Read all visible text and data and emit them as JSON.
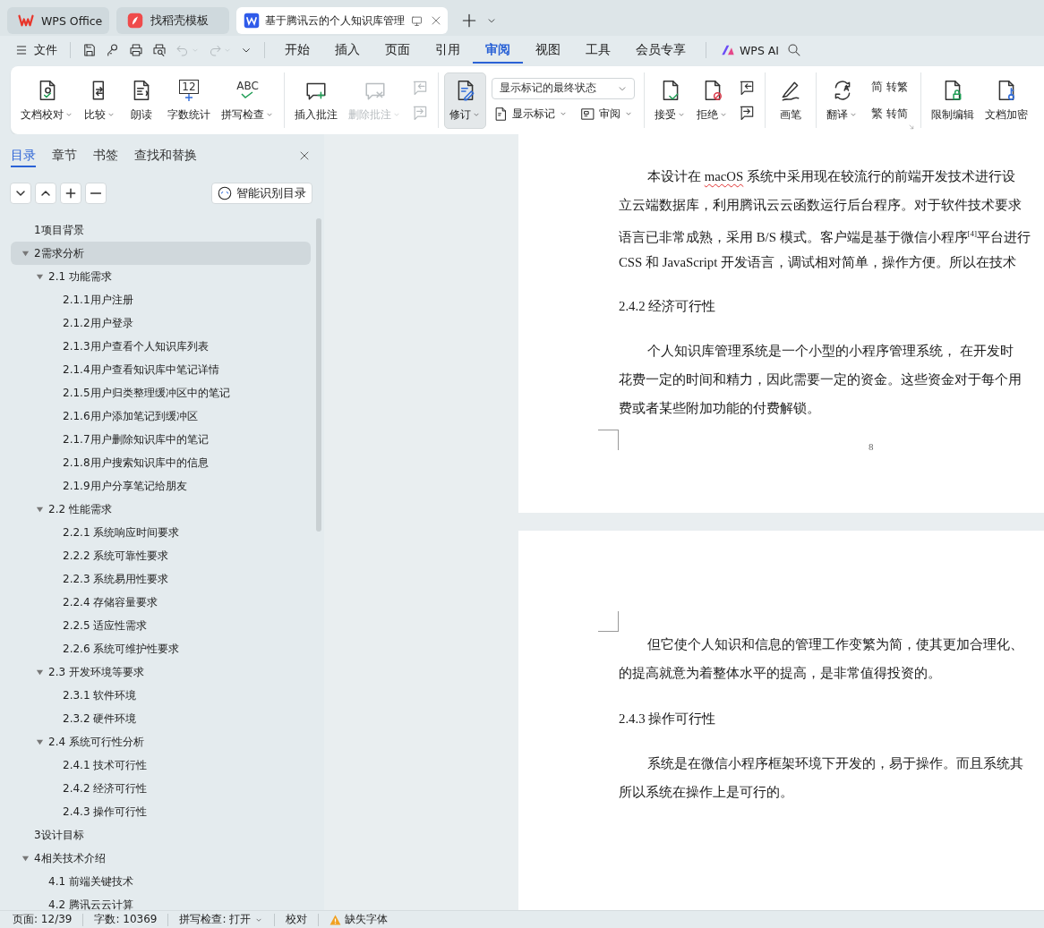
{
  "title_tabs": [
    {
      "label": "WPS Office",
      "selected": false
    },
    {
      "label": "找稻壳模板",
      "selected": false
    },
    {
      "label": "基于腾讯云的个人知识库管理",
      "selected": true
    }
  ],
  "menu_bar": {
    "file_menu": "文件",
    "quick_access": [
      {
        "disabled": false
      },
      {
        "disabled": false
      },
      {
        "disabled": false
      },
      {
        "disabled": false
      },
      {
        "disabled": true
      },
      {
        "disabled": true
      }
    ],
    "tabs": [
      {
        "label": "开始",
        "selected": false
      },
      {
        "label": "插入",
        "selected": false
      },
      {
        "label": "页面",
        "selected": false
      },
      {
        "label": "引用",
        "selected": false
      },
      {
        "label": "审阅",
        "selected": true
      },
      {
        "label": "视图",
        "selected": false
      },
      {
        "label": "工具",
        "selected": false
      },
      {
        "label": "会员专享",
        "selected": false
      }
    ],
    "ai_button": "WPS AI"
  },
  "ribbon": {
    "groups": [
      {
        "items": [
          {
            "kind": "big",
            "label": "文档校对",
            "caret": true,
            "disabled": false,
            "pressed": false
          },
          {
            "kind": "big",
            "label": "比较",
            "caret": true,
            "disabled": false,
            "pressed": false
          },
          {
            "kind": "big",
            "label": "朗读",
            "caret": false,
            "disabled": false,
            "pressed": false
          },
          {
            "kind": "big",
            "label": "字数统计",
            "caret": false,
            "disabled": false,
            "pressed": false,
            "glyph": "12"
          },
          {
            "kind": "big",
            "label": "拼写检查",
            "caret": true,
            "disabled": false,
            "pressed": false,
            "glyph": "ABC"
          }
        ]
      },
      {
        "items": [
          {
            "kind": "big",
            "label": "插入批注",
            "caret": false,
            "disabled": false,
            "pressed": false
          },
          {
            "kind": "big",
            "label": "删除批注",
            "caret": true,
            "disabled": true,
            "pressed": false
          },
          {
            "kind": "nav",
            "disabled": true
          }
        ]
      },
      {
        "items": [
          {
            "kind": "big",
            "label": "修订",
            "caret": true,
            "disabled": false,
            "pressed": true
          },
          {
            "kind": "markup",
            "select": "显示标记的最终状态",
            "buttons": [
              {
                "label": "显示标记",
                "caret": true
              },
              {
                "label": "审阅",
                "caret": true
              }
            ]
          }
        ]
      },
      {
        "items": [
          {
            "kind": "big",
            "label": "接受",
            "caret": true,
            "disabled": false,
            "pressed": false
          },
          {
            "kind": "big",
            "label": "拒绝",
            "caret": true,
            "disabled": false,
            "pressed": false
          },
          {
            "kind": "nav",
            "disabled": false
          }
        ]
      },
      {
        "items": [
          {
            "kind": "big",
            "label": "画笔",
            "caret": false,
            "disabled": false,
            "pressed": false
          }
        ]
      },
      {
        "items": [
          {
            "kind": "big",
            "label": "翻译",
            "caret": true,
            "disabled": false,
            "pressed": false
          },
          {
            "kind": "convert",
            "buttons": [
              {
                "glyph": "简",
                "label": "转繁"
              },
              {
                "glyph": "繁",
                "label": "转简"
              }
            ]
          }
        ],
        "launcher": true
      },
      {
        "items": [
          {
            "kind": "big",
            "label": "限制编辑",
            "caret": false,
            "disabled": false,
            "pressed": false
          },
          {
            "kind": "big",
            "label": "文档加密",
            "caret": false,
            "disabled": false,
            "pressed": false
          }
        ]
      }
    ]
  },
  "outline": {
    "tabs": [
      {
        "label": "目录",
        "selected": true
      },
      {
        "label": "章节",
        "selected": false
      },
      {
        "label": "书签",
        "selected": false
      },
      {
        "label": "查找和替换",
        "selected": false
      }
    ],
    "smart_button": "智能识别目录",
    "items": [
      {
        "label": "1项目背景",
        "selected": false
      },
      {
        "label": "2需求分析",
        "selected": true,
        "expanded": true,
        "children": [
          {
            "label": "2.1 功能需求",
            "selected": false,
            "expanded": true,
            "children": [
              {
                "label": "2.1.1用户注册",
                "selected": false
              },
              {
                "label": "2.1.2用户登录",
                "selected": false
              },
              {
                "label": "2.1.3用户查看个人知识库列表",
                "selected": false
              },
              {
                "label": "2.1.4用户查看知识库中笔记详情",
                "selected": false
              },
              {
                "label": "2.1.5用户归类整理缓冲区中的笔记",
                "selected": false
              },
              {
                "label": "2.1.6用户添加笔记到缓冲区",
                "selected": false
              },
              {
                "label": "2.1.7用户删除知识库中的笔记",
                "selected": false
              },
              {
                "label": "2.1.8用户搜索知识库中的信息",
                "selected": false
              },
              {
                "label": "2.1.9用户分享笔记给朋友",
                "selected": false
              }
            ]
          },
          {
            "label": "2.2  性能需求",
            "selected": false,
            "expanded": true,
            "children": [
              {
                "label": "2.2.1 系统响应时间要求",
                "selected": false
              },
              {
                "label": "2.2.2 系统可靠性要求",
                "selected": false
              },
              {
                "label": "2.2.3 系统易用性要求",
                "selected": false
              },
              {
                "label": "2.2.4 存储容量要求",
                "selected": false
              },
              {
                "label": "2.2.5 适应性需求",
                "selected": false
              },
              {
                "label": "2.2.6  系统可维护性要求",
                "selected": false
              }
            ]
          },
          {
            "label": "2.3 开发环境等要求",
            "selected": false,
            "expanded": true,
            "children": [
              {
                "label": "2.3.1 软件环境",
                "selected": false
              },
              {
                "label": "2.3.2 硬件环境",
                "selected": false
              }
            ]
          },
          {
            "label": "2.4 系统可行性分析",
            "selected": false,
            "expanded": true,
            "children": [
              {
                "label": "2.4.1 技术可行性",
                "selected": false
              },
              {
                "label": "2.4.2 经济可行性",
                "selected": false
              },
              {
                "label": "2.4.3 操作可行性",
                "selected": false
              }
            ]
          }
        ]
      },
      {
        "label": "3设计目标",
        "selected": false
      },
      {
        "label": "4相关技术介绍",
        "selected": false,
        "expanded": true,
        "children": [
          {
            "label": "4.1  前端关键技术",
            "selected": false
          },
          {
            "label": "4.2  腾讯云云计算",
            "selected": false
          }
        ]
      }
    ]
  },
  "document": {
    "pages": [
      {
        "blocks": [
          {
            "kind": "paragraph",
            "lines": [
              {
                "parts": [
                  {
                    "text": "本设计在 ",
                    "misspelled": false
                  },
                  {
                    "text": "macOS",
                    "misspelled": true
                  },
                  {
                    "text": " 系统中采用现在较流行的前端开发技术进行设",
                    "misspelled": false
                  }
                ]
              },
              {
                "text": "立云端数据库，利用腾讯云云函数运行后台程序。对于软件技术要求"
              },
              {
                "text": "语言已非常成熟，采用 B/S 模式。客户端是基于微信小程序$^{[4]}$平台进行"
              },
              {
                "text": "CSS 和 JavaScript 开发语言，调试相对简单，操作方便。所以在技术"
              }
            ]
          },
          {
            "kind": "heading",
            "text": "2.4.2 经济可行性"
          },
          {
            "kind": "paragraph",
            "lines": [
              {
                "text": "个人知识库管理系统是一个小型的小程序管理系统，  在开发时"
              },
              {
                "text": "花费一定的时间和精力，因此需要一定的资金。这些资金对于每个用"
              },
              {
                "text": "费或者某些附加功能的付费解锁。"
              }
            ]
          }
        ],
        "page_number": "8"
      },
      {
        "blocks": [
          {
            "kind": "paragraph",
            "lines": [
              {
                "text": "但它使个人知识和信息的管理工作变繁为简，使其更加合理化、"
              },
              {
                "text": "的提高就意为着整体水平的提高，是非常值得投资的。"
              }
            ]
          },
          {
            "kind": "heading",
            "text": "2.4.3 操作可行性"
          },
          {
            "kind": "paragraph",
            "lines": [
              {
                "text": "系统是在微信小程序框架环境下开发的，易于操作。而且系统其"
              },
              {
                "text": "所以系统在操作上是可行的。"
              }
            ]
          }
        ]
      }
    ]
  },
  "status_bar": [
    {
      "kind": "info",
      "text": "页面: 12/39"
    },
    {
      "kind": "info",
      "text": "字数: 10369"
    },
    {
      "kind": "dropdown",
      "text": "拼写检查: 打开"
    },
    {
      "kind": "button",
      "text": "校对"
    },
    {
      "kind": "warning",
      "text": "缺失字体"
    }
  ]
}
